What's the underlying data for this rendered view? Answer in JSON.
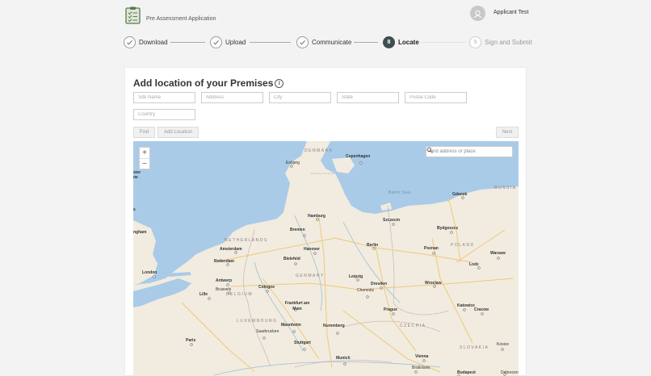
{
  "header": {
    "app_title": "Pre Assessment Application",
    "user_name": "Applicant Test"
  },
  "stepper": {
    "steps": [
      {
        "label": "Download",
        "state": "done",
        "marker": ""
      },
      {
        "label": "Upload",
        "state": "done",
        "marker": ""
      },
      {
        "label": "Communicate",
        "state": "done",
        "marker": ""
      },
      {
        "label": "Locate",
        "state": "active",
        "marker": "8"
      },
      {
        "label": "Sign and Submit",
        "state": "pending",
        "marker": "9"
      }
    ]
  },
  "form": {
    "title": "Add location of your Premises",
    "fields": {
      "site_name": {
        "placeholder": "Site Name",
        "value": ""
      },
      "address": {
        "placeholder": "Address",
        "value": ""
      },
      "city": {
        "placeholder": "City",
        "value": ""
      },
      "state": {
        "placeholder": "State",
        "value": ""
      },
      "postal_code": {
        "placeholder": "Postal Code",
        "value": ""
      },
      "country": {
        "placeholder": "Country",
        "value": ""
      }
    },
    "buttons": {
      "find": "Find",
      "add_location": "Add Location",
      "next": "Next"
    }
  },
  "map": {
    "zoom_in": "+",
    "zoom_out": "−",
    "search_placeholder": "Find address or place",
    "labels": {
      "denmark": "DENMARK",
      "copenhagen": "Copenhagen",
      "esbjerg": "Esbjerg",
      "baltic_sea": "Baltic Sea",
      "gdansk": "Gdansk",
      "russia": "RUSSIA",
      "hamburg": "Hamburg",
      "szczecin": "Szczecin",
      "bremen": "Bremen",
      "bydgoszcz": "Bydgoszcz",
      "netherlands": "NETHERLANDS",
      "amsterdam": "Amsterdam",
      "hanover": "Hanover",
      "berlin": "Berlin",
      "poznan": "Poznan",
      "poland": "POLAND",
      "warsaw": "Warsaw",
      "rotterdam": "Rotterdam",
      "bielefeld": "Bielefeld",
      "lodz": "Lodz",
      "london": "London",
      "germany": "GERMANY",
      "leipzig": "Leipzig",
      "antwerp": "Antwerp",
      "brussels": "Brussels",
      "belgium": "BELGIUM",
      "cologne": "Cologne",
      "dresden": "Dresden",
      "wroclaw": "Wroclaw",
      "lille": "Lille",
      "chemnitz": "Chemnitz",
      "frankfurt": "Frankfurt am Main",
      "katowice": "Katowice",
      "prague": "Prague",
      "krakow": "Cracow",
      "luxembourg": "LUXEMBOURG",
      "mannheim": "Mannheim",
      "nuremberg": "Nuremberg",
      "czechia": "CZECHIA",
      "saarbrucken": "Saarbrucken",
      "slovakia": "SLOVAKIA",
      "paris": "Paris",
      "stuttgart": "Stuttgart",
      "kosice": "Kosice",
      "munich": "Munich",
      "vienna": "Vienna",
      "bratislava": "Bratislava",
      "budapest": "Budapest",
      "debrecen": "Debrecen",
      "edge_ngham": "ngham",
      "edge_s": "s",
      "edge_sterline": "ster\nne"
    }
  },
  "colors": {
    "sea": "#a9cbe8",
    "land": "#f1ecdf",
    "step_active": "#3f4e4e"
  }
}
